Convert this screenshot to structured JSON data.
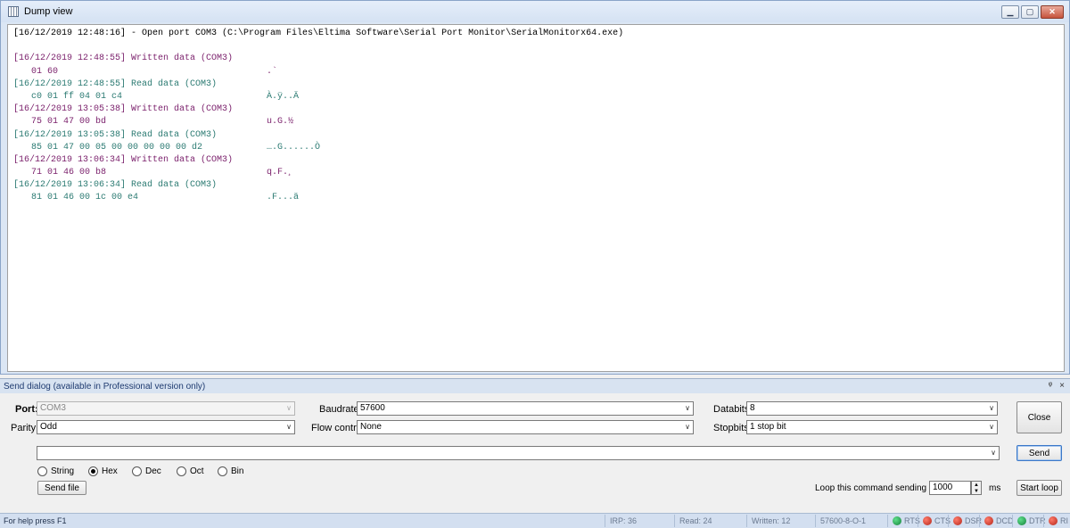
{
  "dump_window": {
    "title": "Dump view",
    "open_line": "[16/12/2019 12:48:16] - Open port COM3 (C:\\Program Files\\Eltima Software\\Serial Port Monitor\\SerialMonitorx64.exe)",
    "entries": [
      {
        "header": "[16/12/2019 12:48:55] Written data (COM3)",
        "kind": "written",
        "hex": "01 60",
        "ascii": ".`"
      },
      {
        "header": "[16/12/2019 12:48:55] Read data (COM3)",
        "kind": "read",
        "hex": "c0 01 ff 04 01 c4",
        "ascii": "À.ÿ..Ä"
      },
      {
        "header": "[16/12/2019 13:05:38] Written data (COM3)",
        "kind": "written",
        "hex": "75 01 47 00 bd",
        "ascii": "u.G.½"
      },
      {
        "header": "[16/12/2019 13:05:38] Read data (COM3)",
        "kind": "read",
        "hex": "85 01 47 00 05 00 00 00 00 00 d2",
        "ascii": "….G......Ò"
      },
      {
        "header": "[16/12/2019 13:06:34] Written data (COM3)",
        "kind": "written",
        "hex": "71 01 46 00 b8",
        "ascii": "q.F.¸"
      },
      {
        "header": "[16/12/2019 13:06:34] Read data (COM3)",
        "kind": "read",
        "hex": "81 01 46 00 1c 00 e4",
        "ascii": ".F...ä"
      }
    ]
  },
  "send_dialog": {
    "header": "Send dialog (available in Professional version only)",
    "pin_glyph": "ᵠ",
    "close_glyph": "×",
    "port_label": "Port:",
    "port_value": "COM3",
    "parity_label": "Parity:",
    "parity_value": "Odd",
    "baudrate_label": "Baudrate:",
    "baudrate_value": "57600",
    "flow_label": "Flow control:",
    "flow_value": "None",
    "databits_label": "Databits:",
    "databits_value": "8",
    "stopbits_label": "Stopbits:",
    "stopbits_value": "1 stop bit",
    "close_button": "Close",
    "send_button": "Send",
    "command_value": "",
    "formats": [
      "String",
      "Hex",
      "Dec",
      "Oct",
      "Bin"
    ],
    "selected_format": "Hex",
    "send_file_button": "Send file",
    "loop_label": "Loop this command sending every",
    "loop_value": "1000",
    "loop_unit": "ms",
    "start_loop_button": "Start loop"
  },
  "status_bar": {
    "help": "For help press F1",
    "irp": "IRP: 36",
    "read": "Read: 24",
    "written": "Written: 12",
    "settings": "57600-8-O-1",
    "signals": [
      {
        "name": "RTS",
        "color": "#14803c"
      },
      {
        "name": "CTS",
        "color": "#b3261a"
      },
      {
        "name": "DSR",
        "color": "#b3261a"
      },
      {
        "name": "DCD",
        "color": "#b3261a"
      },
      {
        "name": "DTR",
        "color": "#14803c"
      },
      {
        "name": "RI",
        "color": "#b3261a"
      }
    ]
  }
}
